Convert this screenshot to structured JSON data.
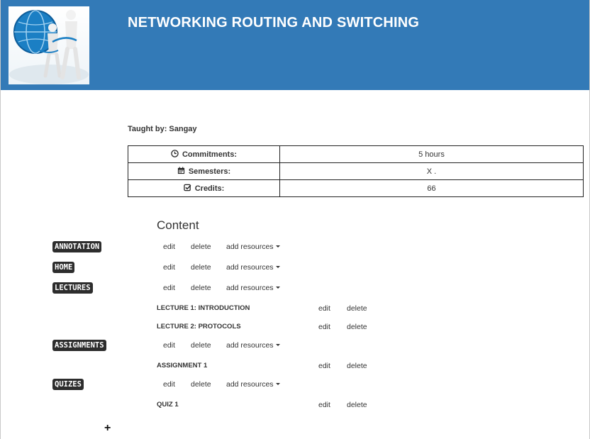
{
  "header": {
    "title": "NETWORKING ROUTING AND SWITCHING",
    "brand_color": "#337ab7"
  },
  "course": {
    "taught_by_label": "Taught by:",
    "instructor": "Sangay",
    "info": [
      {
        "icon": "clock-icon",
        "label": "Commitments:",
        "value": "5 hours"
      },
      {
        "icon": "calendar-icon",
        "label": "Semesters:",
        "value": "X ."
      },
      {
        "icon": "check-square-icon",
        "label": "Credits:",
        "value": "66"
      }
    ]
  },
  "content": {
    "heading": "Content",
    "actions": {
      "edit": "edit",
      "delete": "delete",
      "add_resources": "add resources"
    },
    "sections": [
      {
        "name": "ANNOTATION",
        "items": []
      },
      {
        "name": "HOME",
        "items": []
      },
      {
        "name": "LECTURES",
        "items": [
          "LECTURE 1: INTRODUCTION",
          "LECTURE 2: PROTOCOLS"
        ]
      },
      {
        "name": "ASSIGNMENTS",
        "items": [
          "ASSIGNMENT 1"
        ]
      },
      {
        "name": "QUIZES",
        "items": [
          "QUIZ 1"
        ]
      }
    ]
  },
  "add_button": "+"
}
